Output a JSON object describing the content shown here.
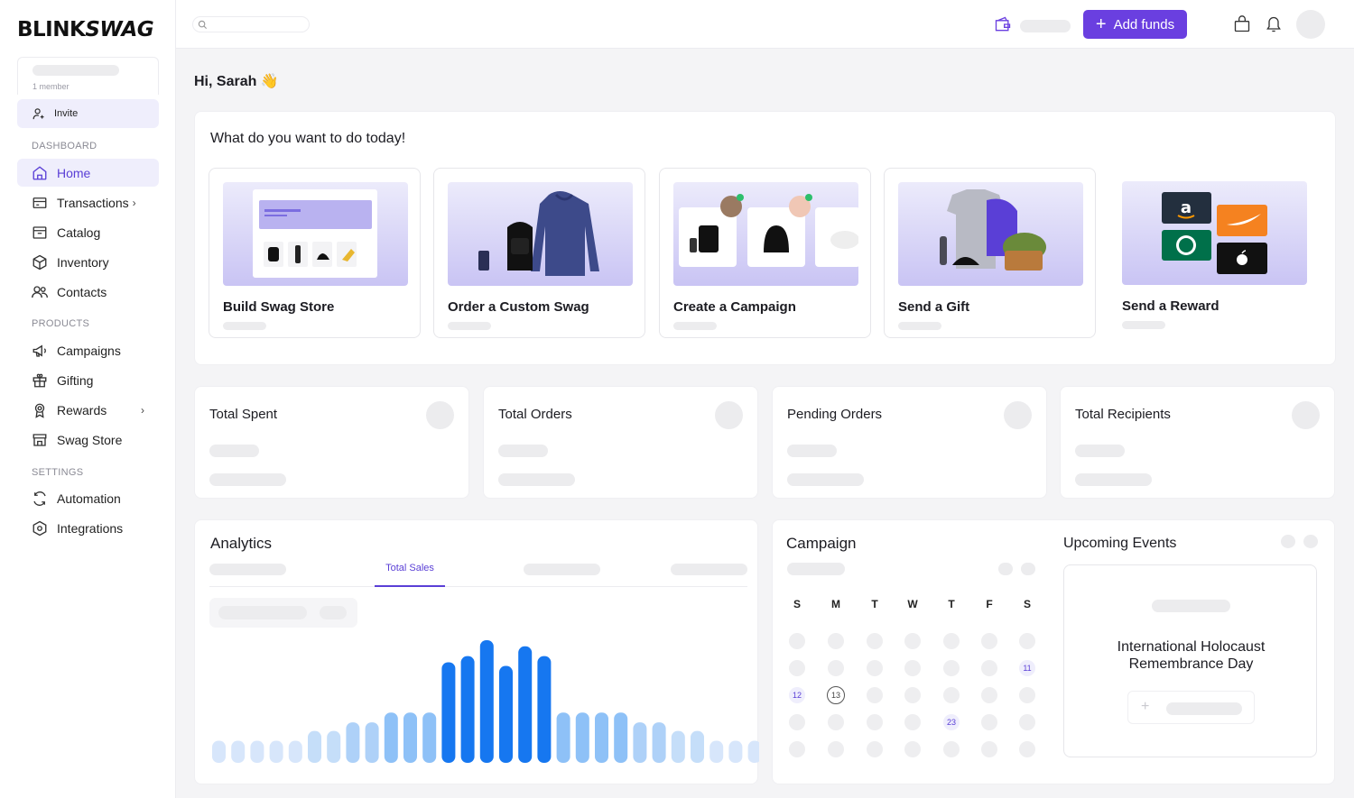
{
  "brand": {
    "logo_text_a": "BLINK",
    "logo_text_b": "SWAG"
  },
  "sidebar": {
    "workspace_members": "1 member",
    "invite_label": "Invite",
    "sections": {
      "dashboard": "DASHBOARD",
      "products": "PRODUCTS",
      "settings": "SETTINGS"
    },
    "items": [
      {
        "label": "Home",
        "icon": "home-icon",
        "active": true
      },
      {
        "label": "Transactions",
        "icon": "receipt-icon"
      },
      {
        "label": "Catalog",
        "icon": "catalog-icon"
      },
      {
        "label": "Inventory",
        "icon": "box-icon"
      },
      {
        "label": "Contacts",
        "icon": "users-icon"
      },
      {
        "label": "Campaigns",
        "icon": "megaphone-icon"
      },
      {
        "label": "Gifting",
        "icon": "gift-icon"
      },
      {
        "label": "Rewards",
        "icon": "award-icon"
      },
      {
        "label": "Swag Store",
        "icon": "store-icon"
      },
      {
        "label": "Automation",
        "icon": "refresh-icon"
      },
      {
        "label": "Integrations",
        "icon": "hexagon-icon"
      }
    ]
  },
  "topbar": {
    "add_funds_label": "Add funds",
    "accent": "#6a3fe0"
  },
  "greeting": "Hi, Sarah",
  "greeting_emoji": "👋",
  "actions": {
    "title": "What do you want to do today!",
    "cards": [
      {
        "label": "Build Swag Store"
      },
      {
        "label": "Order a Custom Swag"
      },
      {
        "label": "Create a Campaign"
      },
      {
        "label": "Send a Gift"
      },
      {
        "label": "Send a Reward"
      }
    ]
  },
  "stats": [
    {
      "title": "Total Spent"
    },
    {
      "title": "Total Orders"
    },
    {
      "title": "Pending Orders"
    },
    {
      "title": "Total Recipients"
    }
  ],
  "analytics": {
    "title": "Analytics",
    "active_tab": "Total Sales",
    "chart_data": {
      "type": "bar",
      "values": [
        0.18,
        0.18,
        0.18,
        0.18,
        0.18,
        0.26,
        0.26,
        0.33,
        0.33,
        0.41,
        0.41,
        0.41,
        0.82,
        0.87,
        1.0,
        0.79,
        0.95,
        0.87,
        0.41,
        0.41,
        0.41,
        0.41,
        0.33,
        0.33,
        0.26,
        0.26,
        0.18,
        0.18,
        0.18
      ]
    }
  },
  "campaign": {
    "title": "Campaign",
    "weekdays": [
      "S",
      "M",
      "T",
      "W",
      "T",
      "F",
      "S"
    ],
    "marked_days": {
      "11": "tinted",
      "12": "tinted",
      "13": "today",
      "23": "tinted"
    }
  },
  "events": {
    "title": "Upcoming Events",
    "event_name": "International Holocaust Remembrance Day"
  }
}
